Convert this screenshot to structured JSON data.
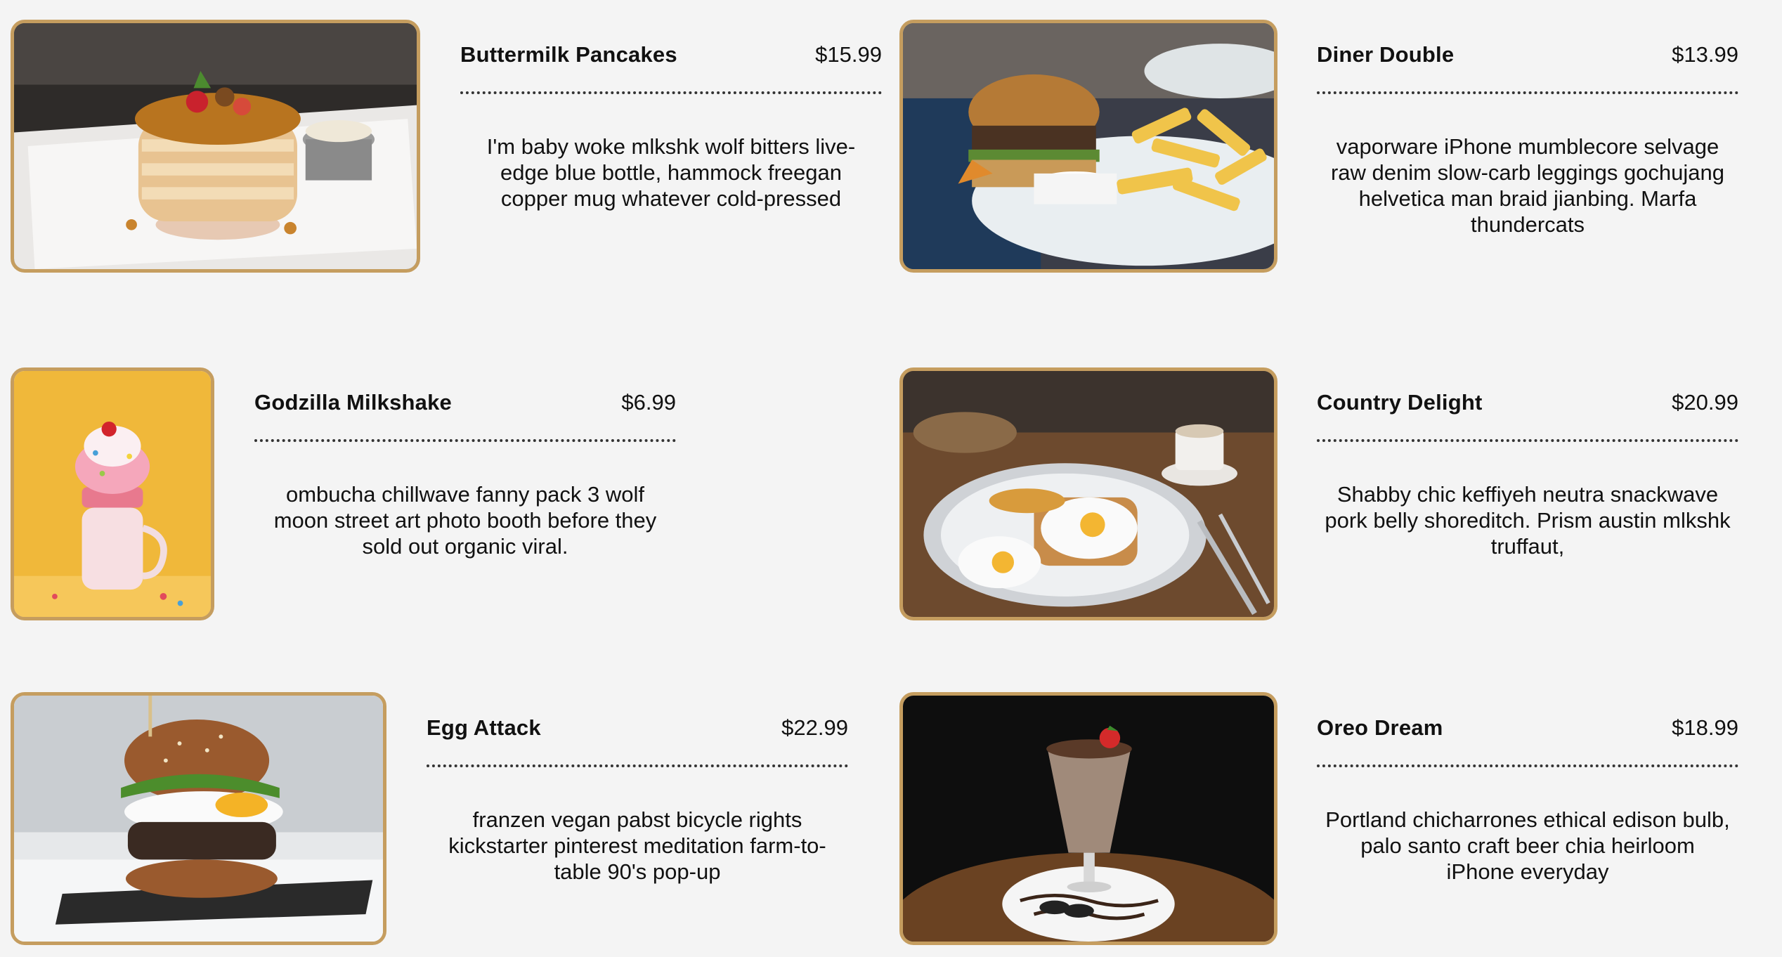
{
  "theme": {
    "background": "#f4f4f4",
    "accent": "#c59d5f",
    "text": "#111111"
  },
  "menu": {
    "items": [
      {
        "title": "Buttermilk Pancakes",
        "price": "$15.99",
        "desc": "I'm baby woke mlkshk wolf bitters live-edge blue bottle, hammock freegan copper mug whatever cold-pressed",
        "image": "pancakes-photo"
      },
      {
        "title": "Diner Double",
        "price": "$13.99",
        "desc": "vaporware iPhone mumblecore selvage raw denim slow-carb leggings gochujang helvetica man braid jianbing. Marfa thundercats",
        "image": "burger-fries-photo"
      },
      {
        "title": "Godzilla Milkshake",
        "price": "$6.99",
        "desc": "ombucha chillwave fanny pack 3 wolf moon street art photo booth before they sold out organic viral.",
        "image": "milkshake-photo"
      },
      {
        "title": "Country Delight",
        "price": "$20.99",
        "desc": "Shabby chic keffiyeh neutra snackwave pork belly shoreditch. Prism austin mlkshk truffaut,",
        "image": "eggs-toast-photo"
      },
      {
        "title": "Egg Attack",
        "price": "$22.99",
        "desc": "franzen vegan pabst bicycle rights kickstarter pinterest meditation farm-to-table 90's pop-up",
        "image": "egg-burger-photo"
      },
      {
        "title": "Oreo Dream",
        "price": "$18.99",
        "desc": "Portland chicharrones ethical edison bulb, palo santo craft beer chia heirloom iPhone everyday",
        "image": "oreo-shake-photo"
      }
    ]
  }
}
